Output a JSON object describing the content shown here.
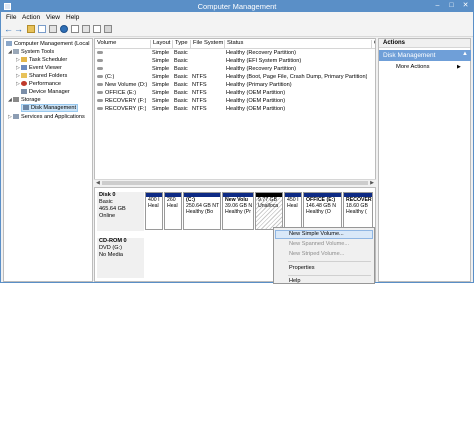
{
  "window": {
    "title": "Computer Management"
  },
  "menubar": [
    "File",
    "Action",
    "View",
    "Help"
  ],
  "tree": [
    {
      "label": "Computer Management (Local",
      "level": 0
    },
    {
      "label": "System Tools",
      "level": 1
    },
    {
      "label": "Task Scheduler",
      "level": 2
    },
    {
      "label": "Event Viewer",
      "level": 2
    },
    {
      "label": "Shared Folders",
      "level": 2
    },
    {
      "label": "Performance",
      "level": 2
    },
    {
      "label": "Device Manager",
      "level": 2
    },
    {
      "label": "Storage",
      "level": 1
    },
    {
      "label": "Disk Management",
      "level": 2
    },
    {
      "label": "Services and Applications",
      "level": 1
    }
  ],
  "volume_table": {
    "columns": [
      "Volume",
      "Layout",
      "Type",
      "File System",
      "Status",
      "C"
    ],
    "rows": [
      [
        "",
        "Simple",
        "Basic",
        "",
        "Healthy (Recovery Partition)"
      ],
      [
        "",
        "Simple",
        "Basic",
        "",
        "Healthy (EFI System Partition)"
      ],
      [
        "",
        "Simple",
        "Basic",
        "",
        "Healthy (Recovery Partition)"
      ],
      [
        "(C:)",
        "Simple",
        "Basic",
        "NTFS",
        "Healthy (Boot, Page File, Crash Dump, Primary Partition)"
      ],
      [
        "New Volume (D:)",
        "Simple",
        "Basic",
        "NTFS",
        "Healthy (Primary Partition)"
      ],
      [
        "OFFICE (E:)",
        "Simple",
        "Basic",
        "NTFS",
        "Healthy (OEM Partition)"
      ],
      [
        "RECOVERY (F:)",
        "Simple",
        "Basic",
        "NTFS",
        "Healthy (OEM Partition)"
      ],
      [
        "RECOVERY (F:)",
        "Simple",
        "Basic",
        "NTFS",
        "Healthy (OEM Partition)"
      ]
    ]
  },
  "disks": [
    {
      "lines": [
        "Disk 0",
        "Basic",
        "465.64 GB",
        "Online"
      ],
      "partitions": [
        {
          "name": "",
          "lines": [
            "400 I",
            "Heal"
          ]
        },
        {
          "name": "",
          "lines": [
            "260",
            "Heal"
          ]
        },
        {
          "name": "(C:)",
          "lines": [
            "250.64 GB NT",
            "Healthy (Bo"
          ]
        },
        {
          "name": "New Volu",
          "lines": [
            "39.06 GB N",
            "Healthy (Pr"
          ]
        },
        {
          "name": "",
          "lines": [
            "9.77 GB",
            "Unalloca"
          ]
        },
        {
          "name": "",
          "lines": [
            "450 I",
            "Heal"
          ]
        },
        {
          "name": "OFFICE (E:)",
          "lines": [
            "146.48 GB N",
            "Healthy (O"
          ]
        },
        {
          "name": "RECOVER",
          "lines": [
            "18.60 GB",
            "Healthy ("
          ]
        }
      ]
    },
    {
      "lines": [
        "CD-ROM 0",
        "DVD (G:)",
        "",
        "No Media"
      ]
    }
  ],
  "actions": {
    "header": "Actions",
    "section": "Disk Management",
    "items": [
      "More Actions"
    ]
  },
  "context_menu": {
    "items": [
      "New Simple Volume...",
      "New Spanned Volume...",
      "New Striped Volume...",
      "Properties",
      "Help"
    ]
  }
}
